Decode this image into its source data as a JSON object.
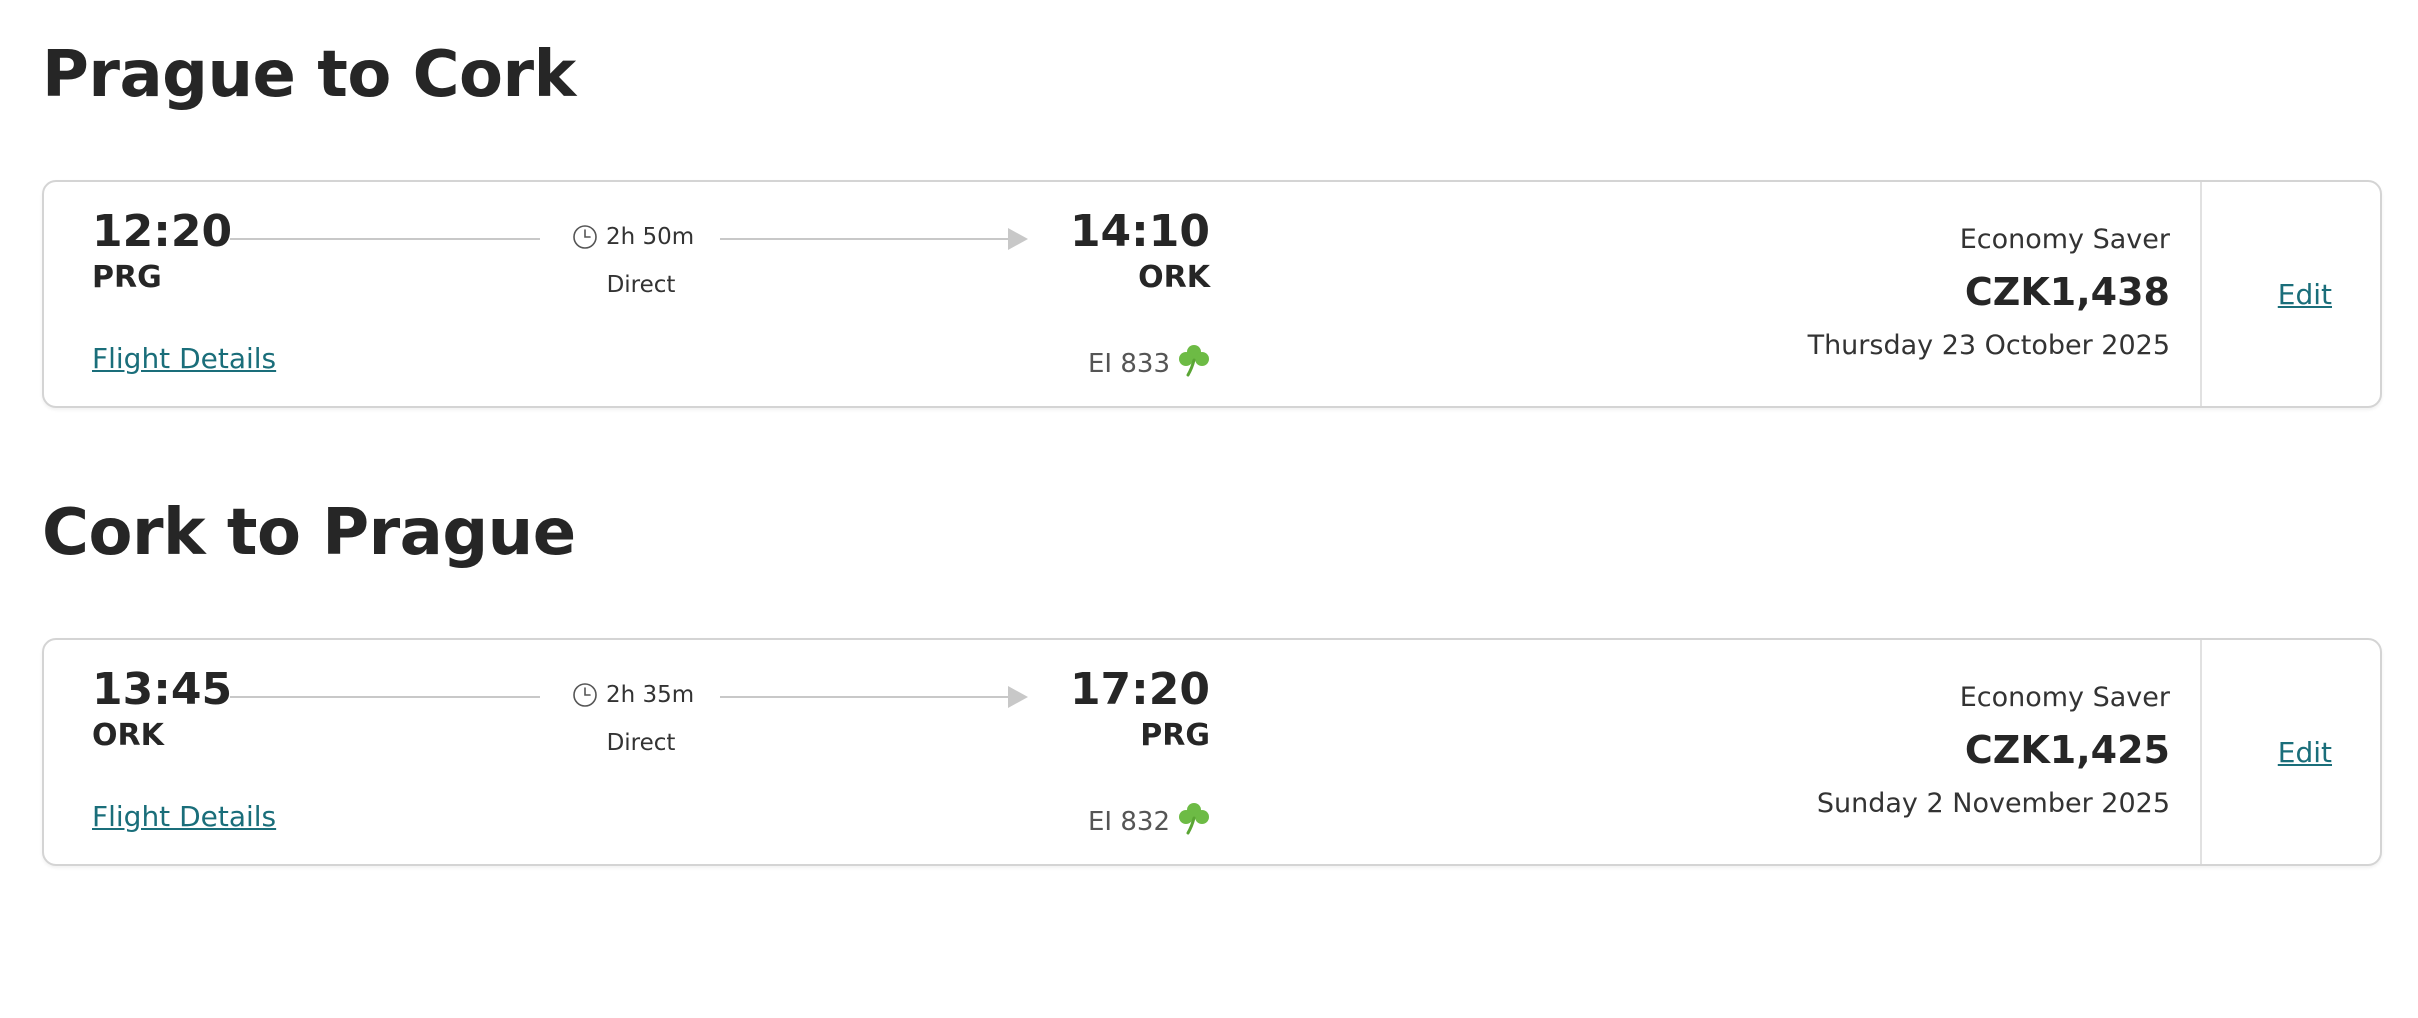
{
  "outbound": {
    "title": "Prague to Cork",
    "departure_time": "12:20",
    "departure_code": "PRG",
    "duration": "2h 50m",
    "stops": "Direct",
    "arrival_time": "14:10",
    "arrival_code": "ORK",
    "details_label": "Flight Details",
    "flight_number": "EI 833",
    "fare_class": "Economy Saver",
    "price": "CZK1,438",
    "date": "Thursday 23 October 2025",
    "edit_label": "Edit"
  },
  "return": {
    "title": "Cork to Prague",
    "departure_time": "13:45",
    "departure_code": "ORK",
    "duration": "2h 35m",
    "stops": "Direct",
    "arrival_time": "17:20",
    "arrival_code": "PRG",
    "details_label": "Flight Details",
    "flight_number": "EI 832",
    "fare_class": "Economy Saver",
    "price": "CZK1,425",
    "date": "Sunday 2 November 2025",
    "edit_label": "Edit"
  },
  "icons": {
    "duration": "clock-icon",
    "airline": "shamrock-icon",
    "arrow": "arrow-right-icon"
  },
  "colors": {
    "link": "#1a6e7a",
    "shamrock": "#6dbb45",
    "border": "#d4d4d4"
  }
}
